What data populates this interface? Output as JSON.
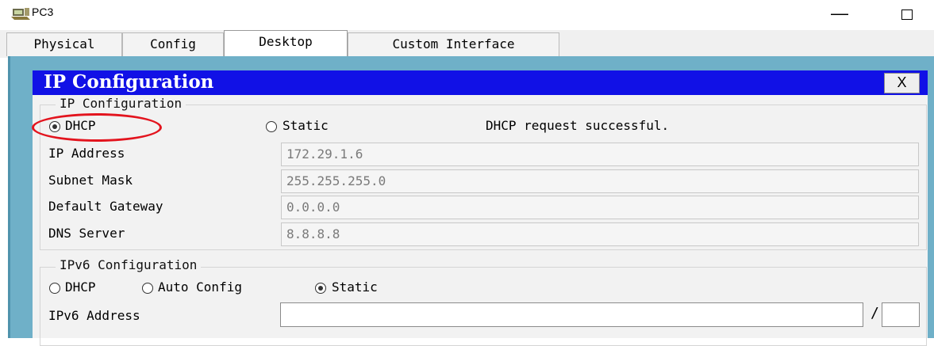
{
  "window": {
    "title": "PC3",
    "minimize_glyph": "—",
    "maximize_glyph": "☐",
    "icon": "pc-icon"
  },
  "tabs": [
    {
      "label": "Physical",
      "active": false
    },
    {
      "label": "Config",
      "active": false
    },
    {
      "label": "Desktop",
      "active": true
    },
    {
      "label": "Custom Interface",
      "active": false
    }
  ],
  "ip_configuration": {
    "window_title": "IP Configuration",
    "close_label": "X",
    "ipv4": {
      "legend": "IP Configuration",
      "mode_dhcp_label": "DHCP",
      "mode_static_label": "Static",
      "selected_mode": "DHCP",
      "status": "DHCP request successful.",
      "ip_address_label": "IP Address",
      "ip_address": "172.29.1.6",
      "subnet_mask_label": "Subnet Mask",
      "subnet_mask": "255.255.255.0",
      "default_gateway_label": "Default Gateway",
      "default_gateway": "0.0.0.0",
      "dns_server_label": "DNS Server",
      "dns_server": "8.8.8.8"
    },
    "ipv6": {
      "legend": "IPv6 Configuration",
      "mode_dhcp_label": "DHCP",
      "mode_auto_label": "Auto Config",
      "mode_static_label": "Static",
      "selected_mode": "Static",
      "address_label": "IPv6 Address",
      "address": "",
      "prefix_separator": "/",
      "prefix_length": ""
    }
  },
  "colors": {
    "title_bar": "#1111e6",
    "desktop_bg": "#6fb0c8",
    "highlight": "#e3141e"
  }
}
